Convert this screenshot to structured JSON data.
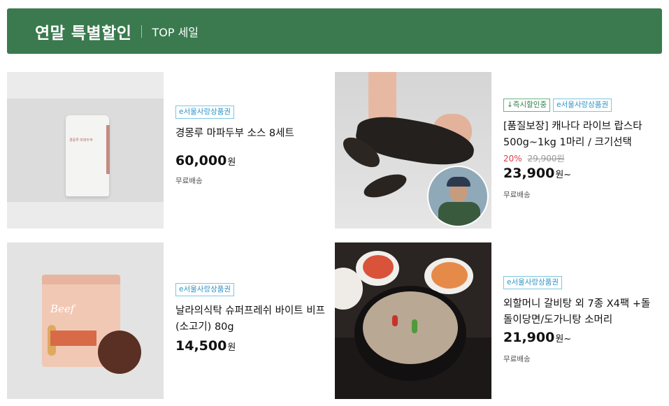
{
  "banner": {
    "title": "연말 특별할인",
    "subtitle": "TOP 세일",
    "background_color": "#3a7a4e"
  },
  "products": [
    {
      "badges": [
        "e서울사랑상품권"
      ],
      "name": "경몽루 마파두부 소스 8세트",
      "price": "60,000",
      "currency": "원",
      "shipping": "무료배송",
      "thumbnail_label": "경몽루 마파두부"
    },
    {
      "badges": [
        "↓즉시할인중",
        "e서울사랑상품권"
      ],
      "name": "[품질보장] 캐나다 라이브 랍스타 500g~1kg 1마리 / 크기선택",
      "discount": "20%",
      "original_price": "29,900원",
      "price": "23,900",
      "currency": "원~",
      "shipping": "무료배송"
    },
    {
      "badges": [
        "e서울사랑상품권"
      ],
      "name": "날라의식탁 슈퍼프레쉬 바이트 비프 (소고기) 80g",
      "price": "14,500",
      "currency": "원",
      "thumbnail_label": "Beef"
    },
    {
      "badges": [
        "e서울사랑상품권"
      ],
      "name": "외할머니 갈비탕 외 7종 X4팩 +돌돌이당면/도가니탕 소머리",
      "price": "21,900",
      "currency": "원~",
      "shipping": "무료배송"
    }
  ],
  "colors": {
    "discount": "#e23a4f",
    "badge_blue": "#2f93c2",
    "badge_green": "#2f7d4b"
  }
}
